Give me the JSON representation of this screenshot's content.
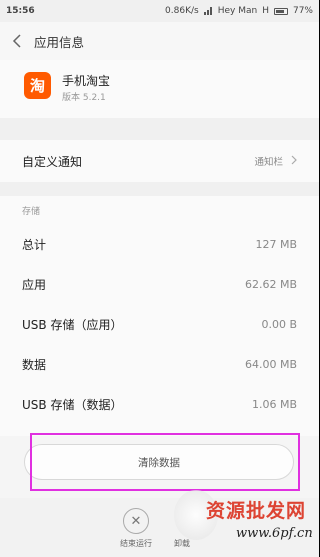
{
  "status_bar": {
    "time": "15:56",
    "network_speed": "0.86K/s",
    "carrier": "Hey Man",
    "network_type": "H",
    "battery": "77%"
  },
  "header": {
    "title": "应用信息"
  },
  "app": {
    "icon_char": "淘",
    "name": "手机淘宝",
    "version": "版本 5.2.1"
  },
  "notification": {
    "label": "自定义通知",
    "value": "通知栏"
  },
  "storage": {
    "header": "存储",
    "rows": [
      {
        "label": "总计",
        "value": "127 MB"
      },
      {
        "label": "应用",
        "value": "62.62 MB"
      },
      {
        "label": "USB 存储（应用）",
        "value": "0.00 B"
      },
      {
        "label": "数据",
        "value": "64.00 MB"
      },
      {
        "label": "USB 存储（数据）",
        "value": "1.06 MB"
      }
    ]
  },
  "actions": {
    "clear_data": "清除数据",
    "stop": "结束运行",
    "uninstall": "卸载"
  },
  "watermark": {
    "text": "资源批发网",
    "url": "www.6pf.cn"
  },
  "colors": {
    "app_icon": "#ff5a00",
    "highlight": "#e030e0"
  }
}
